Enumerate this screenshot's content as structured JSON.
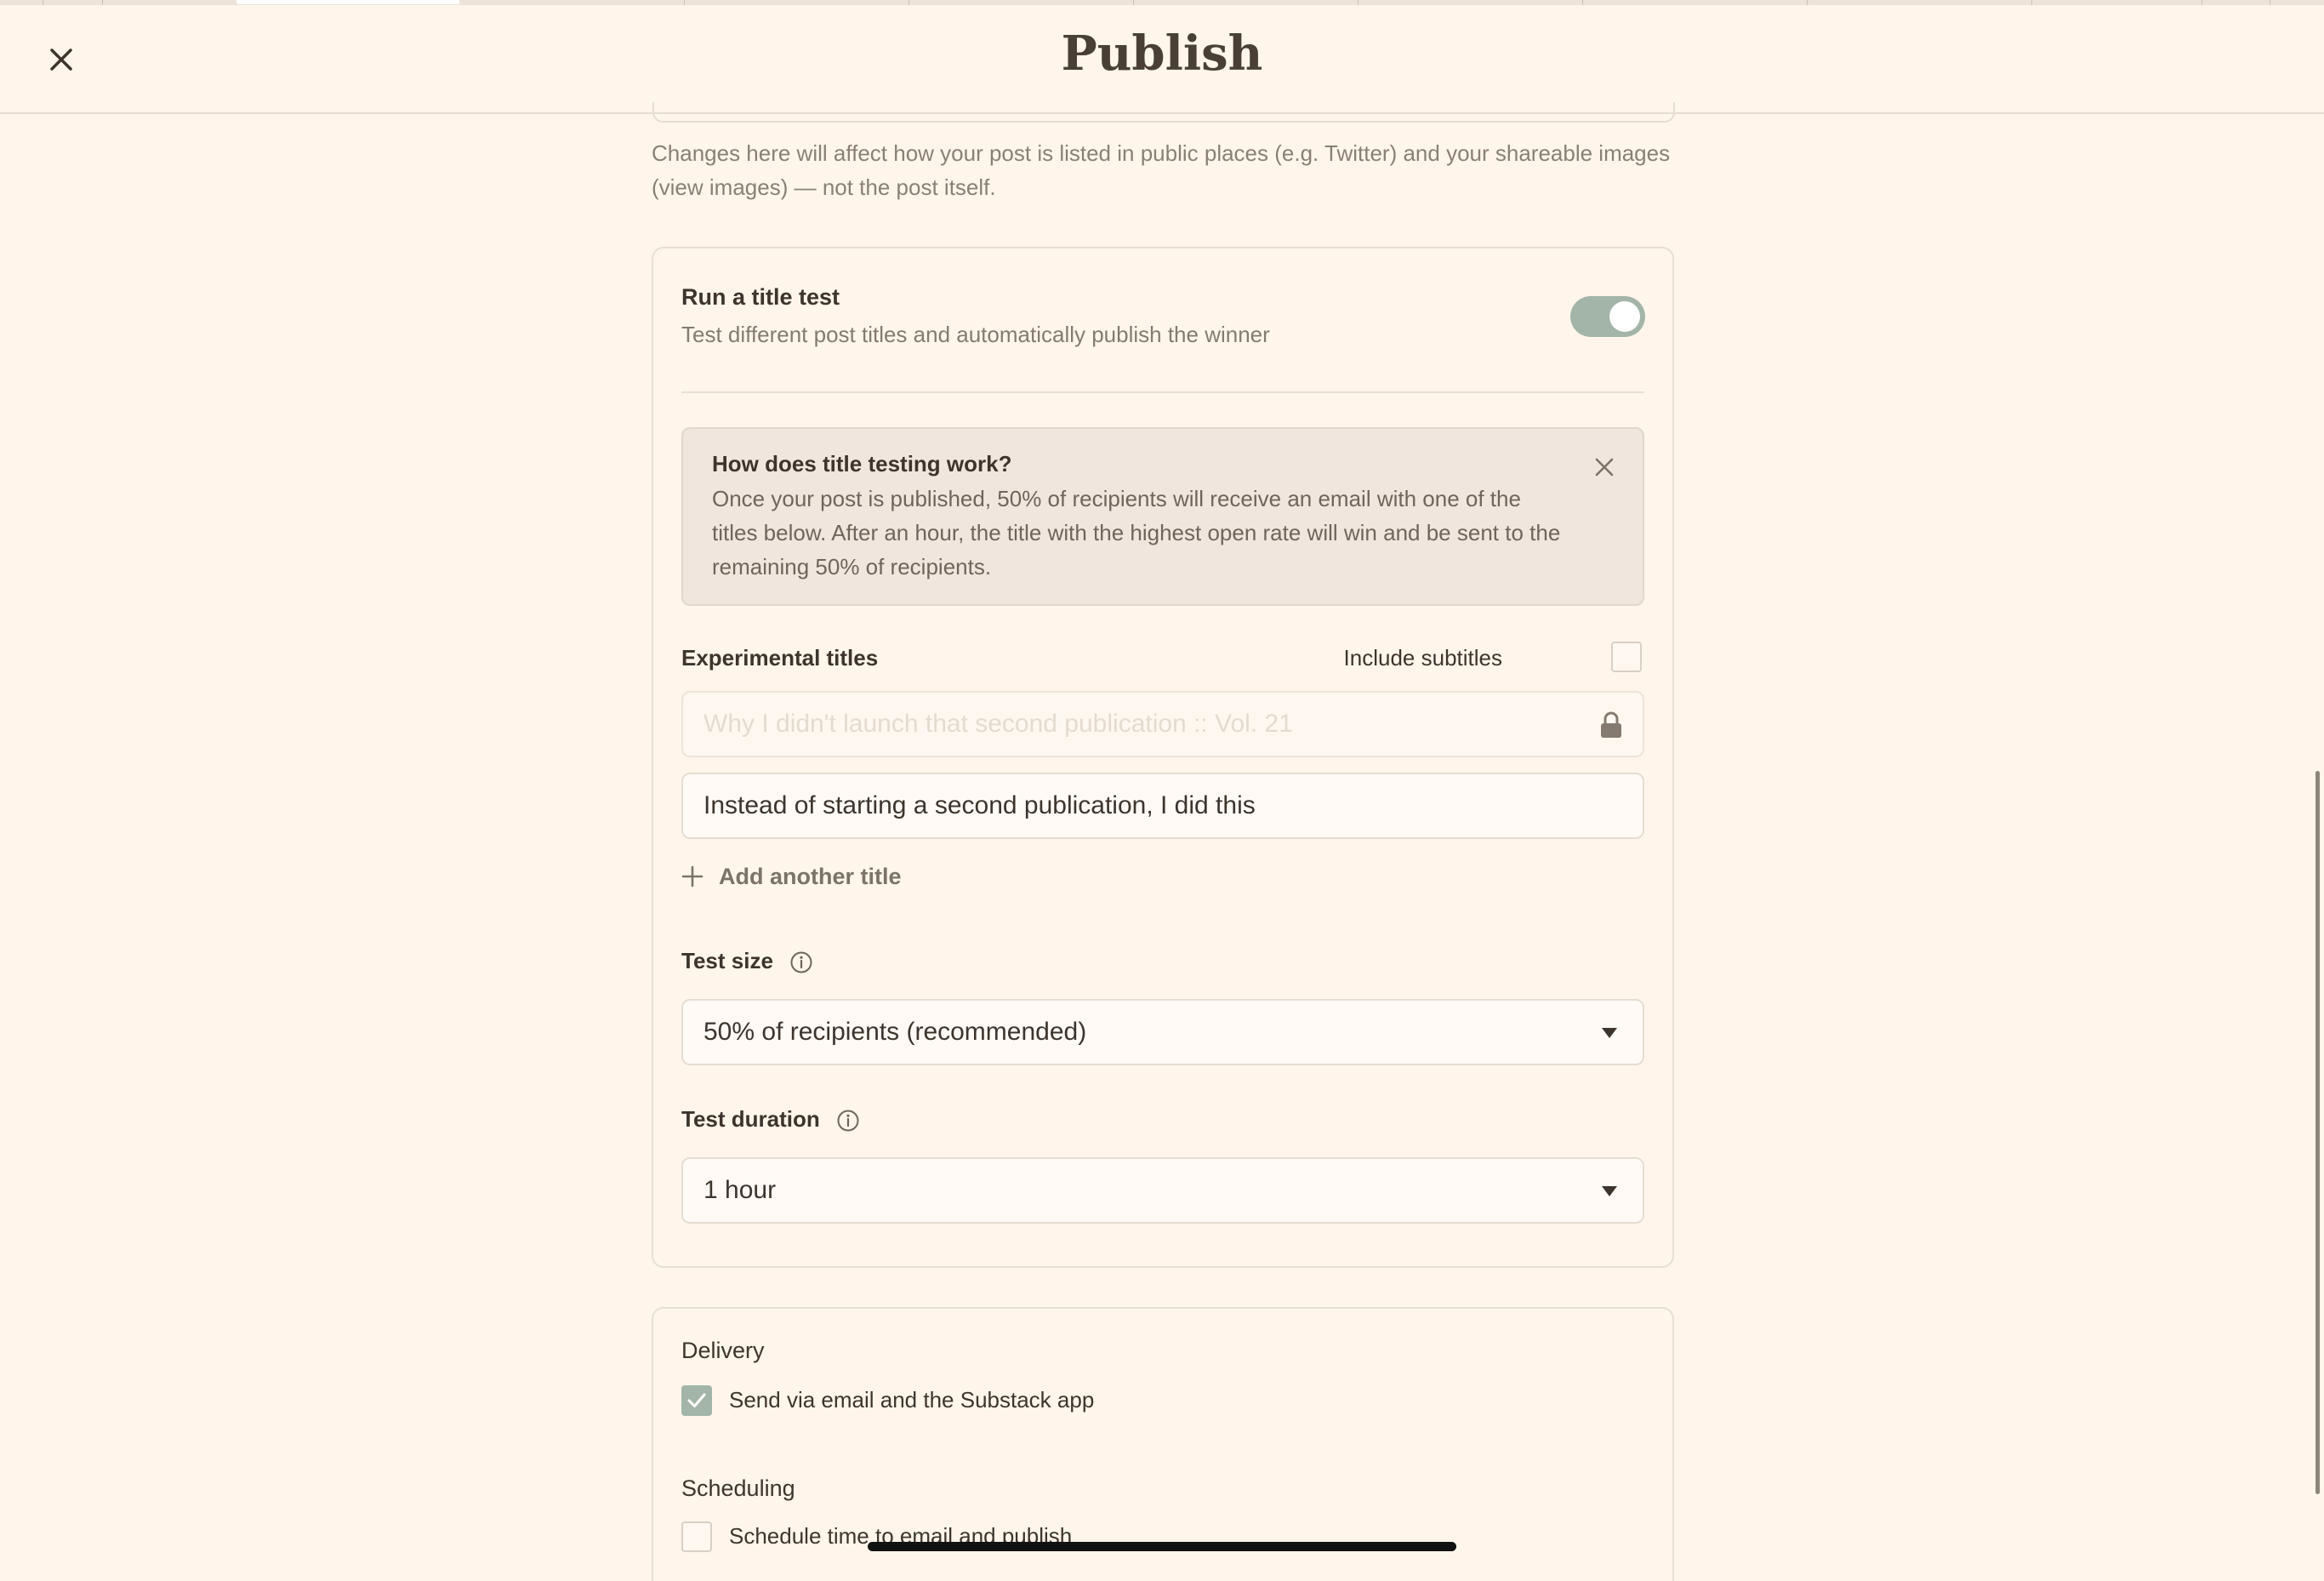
{
  "header": {
    "title": "Publish",
    "close_icon": "close-icon"
  },
  "listing_note": "Changes here will affect how your post is listed in public places (e.g. Twitter) and your shareable images (view images) — not the post itself.",
  "title_test": {
    "heading": "Run a title test",
    "description": "Test different post titles and automatically publish the winner",
    "enabled": true,
    "info": {
      "title": "How does title testing work?",
      "body": "Once your post is published, 50% of recipients will receive an email with one of the titles below. After an hour, the title with the highest open rate will win and be sent to the remaining 50% of recipients."
    },
    "experimental_titles_label": "Experimental titles",
    "include_subtitles_label": "Include subtitles",
    "include_subtitles_checked": false,
    "titles": [
      {
        "value": "Why I didn't launch that second publication :: Vol. 21",
        "locked": true
      },
      {
        "value": "Instead of starting a second publication, I did this",
        "locked": false
      }
    ],
    "add_title_label": "Add another title",
    "test_size": {
      "label": "Test size",
      "value": "50% of recipients (recommended)"
    },
    "test_duration": {
      "label": "Test duration",
      "value": "1 hour"
    }
  },
  "delivery": {
    "heading": "Delivery",
    "send_label": "Send via email and the Substack app",
    "send_checked": true
  },
  "scheduling": {
    "heading": "Scheduling",
    "schedule_label": "Schedule time to email and publish",
    "schedule_checked": false
  },
  "colors": {
    "background": "#fff5eb",
    "accent": "#a3b5a9",
    "text": "#3d352d",
    "muted": "#857a70"
  }
}
